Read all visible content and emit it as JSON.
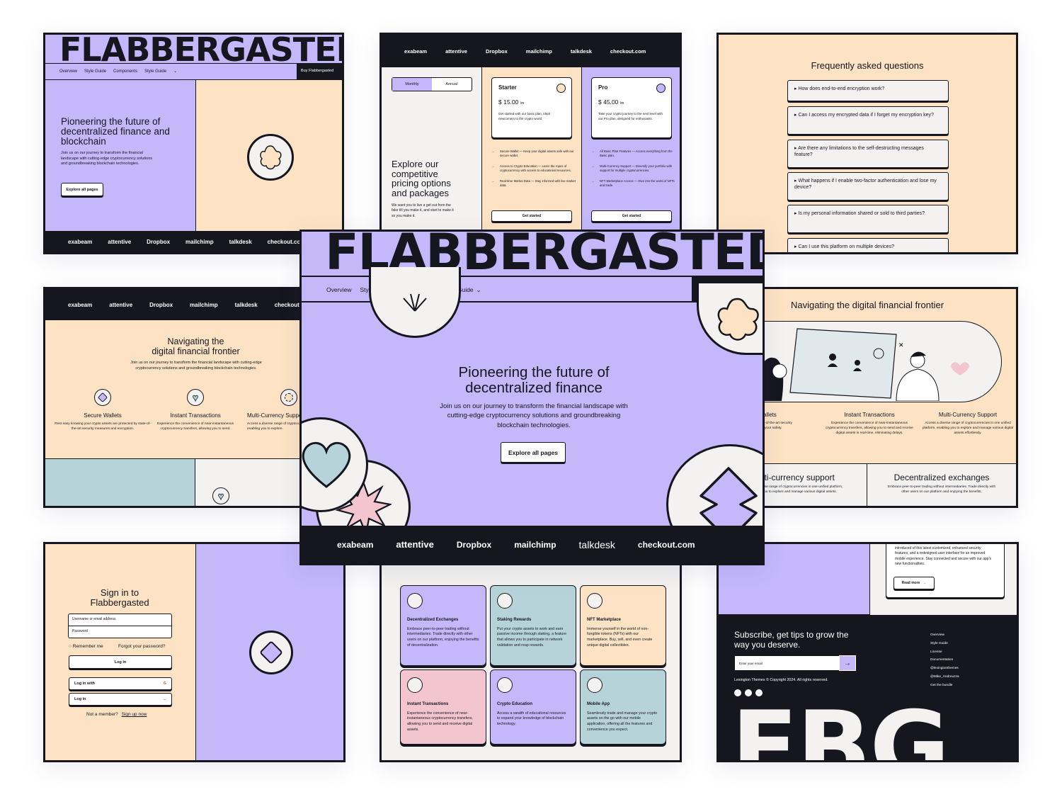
{
  "brand": "FLABBERGASTED",
  "nav": {
    "items": [
      "Overview",
      "Style Guide",
      "Components"
    ],
    "dropdown": "Style Guide",
    "buy": "Buy Flabbergasted"
  },
  "hero": {
    "title_small": "Pioneering the future of decentralized finance and blockchain",
    "title_main": "Pioneering the future of decentralized finance",
    "body": "Join us on our journey to transform the financial landscape with cutting-edge cryptocurrency solutions and groundbreaking blockchain technologies.",
    "cta": "Explore all pages"
  },
  "logos": [
    "exabeam",
    "attentive",
    "Dropbox",
    "mailchimp",
    "talkdesk",
    "checkout.com"
  ],
  "pricing": {
    "toggle": [
      "Monthly",
      "Annual"
    ],
    "title": "Explore our competitive pricing options and packages",
    "body": "We want you to live a get out from the fake till you make it, and start to make it so you make it.",
    "plans": [
      {
        "name": "Starter",
        "price": "$ 15.00",
        "per": "/m",
        "desc": "Get started with our basic plan, ideal newcomers to the crypto world.",
        "features": [
          "Secure Wallet — Keep your digital assets safe with our secure wallet.",
          "Access to Crypto Education — Learn the ropes of cryptocurrency with access to educational resources.",
          "Real-time Market Data — Stay informed with live market data."
        ],
        "cta": "Get started"
      },
      {
        "name": "Pro",
        "price": "$ 45.00",
        "per": "/m",
        "desc": "Take your crypto journey to the next level with our Pro plan, designed for enthusiasts.",
        "features": [
          "All Basic Plan Features — Access everything from the Basic plan.",
          "Multi-Currency Support — Diversify your portfolio with support for multiple cryptocurrencies.",
          "NFT Marketplace Access — Dive into the world of NFTs and trade."
        ],
        "cta": "Get started"
      }
    ]
  },
  "faq": {
    "title": "Frequently asked questions",
    "items": [
      "▸ How does end-to-end encryption work?",
      "▸ Can I access my encrypted data if I forget my encryption key?",
      "▸ Are there any limitations to the self-destructing messages feature?",
      "▸ What happens if I enable two-factor authentication and lose my device?",
      "▸ Is my personal information shared or sold to third parties?",
      "▸ Can I use this platform on multiple devices?"
    ]
  },
  "features": {
    "title": "Navigating the digital financial frontier",
    "title_l1": "Navigating the",
    "title_l2": "digital financial frontier",
    "body": "Join us on our journey to transform the financial landscape with cutting-edge cryptocurrency solutions and groundbreaking blockchain technologies.",
    "items": [
      {
        "name": "Secure Wallets",
        "desc": "Rest easy knowing your crypto assets are protected by state-of-the-art security measures and encryption."
      },
      {
        "name": "Instant Transactions",
        "desc": "Experience the convenience of near-instantaneous cryptocurrency transfers, allowing you to send."
      },
      {
        "name": "Multi-Currency Support",
        "desc": "Access a diverse range of cryptocurrencies in one unified platform, enabling you to explore."
      }
    ],
    "right_items": [
      {
        "name": "Secure Wallets",
        "desc": "your crypto assets are state-of-the-art security encryption, ensuring your safety."
      },
      {
        "name": "Instant Transactions",
        "desc": "Experience the convenience of near-instantaneous cryptocurrency transfers, allowing you to send and receive digital assets in real-time, eliminating delays."
      },
      {
        "name": "Multi-Currency Support",
        "desc": "Access a diverse range of cryptocurrencies in one unified platform, enabling you to explore and manage various digital assets effortlessly."
      }
    ],
    "bottom": [
      {
        "name": "Multi-currency support",
        "desc": "Access a diverse range of cryptocurrencies in one unified platform, enabling you to explore and manage various digital assets."
      },
      {
        "name": "Decentralized exchanges",
        "desc": "Embrace peer-to-peer trading without intermediaries. Trade directly with other users on our platform and enjoying the benefits."
      }
    ]
  },
  "signin": {
    "title": "Sign in to Flabbergasted",
    "username": "Username or email address",
    "password": "Password",
    "remember": "Remember me",
    "forgot": "Forgot your password?",
    "login": "Log in",
    "login_with": "Log in with",
    "login2": "Log in",
    "member": "Not a member?",
    "signup": "Sign up now"
  },
  "grid": [
    {
      "name": "Decentralized Exchanges",
      "desc": "Embrace peer-to-peer trading without intermediaries. Trade directly with other users on our platform, enjoying the benefits of decentralization.",
      "color": "#c4b8fb"
    },
    {
      "name": "Staking Rewards",
      "desc": "Put your crypto assets to work and earn passive income through staking, a feature that allows you to participate in network validation and reap rewards.",
      "color": "#b6d3da"
    },
    {
      "name": "NFT Marketplace",
      "desc": "Immerse yourself in the world of non-fungible tokens (NFTs) with our marketplace. Buy, sell, and even create unique digital collectibles.",
      "color": "#fde3c4"
    },
    {
      "name": "Instant Transactions",
      "desc": "Experience the convenience of near-instantaneous cryptocurrency transfers, allowing you to send and receive digital assets.",
      "color": "#f2c5cf"
    },
    {
      "name": "Crypto Education",
      "desc": "Access a wealth of educational resources to expand your knowledge of blockchain technology.",
      "color": "#c4b8fb"
    },
    {
      "name": "Mobile App",
      "desc": "Seamlessly trade and manage your crypto assets on the go with our mobile application, offering all the features and convenience you expect.",
      "color": "#b6d3da"
    }
  ],
  "footer": {
    "blog_text": "introduced of this latest customized, enhanced security features, and a redesigned user interface for an improved mobile experience. Stay connected and secure with our app's new functionalities.",
    "read_more": "Read more",
    "subscribe": "Subscribe, get tips to grow the way you deserve.",
    "email_placeholder": "Enter your email",
    "copyright": "Lexington Themes © Copyright 2024. All rights reserved.",
    "links": [
      "Overview",
      "Style Guide",
      "License",
      "Documentation",
      "@lexingtonthemes",
      "@Mike_Andreuzza",
      "Get the bundle"
    ],
    "big": "FBG"
  },
  "colors": {
    "lavender": "#c4b8fb",
    "peach": "#fde3c4",
    "blue": "#b6d3da",
    "pink": "#f2c5cf",
    "dark": "#16161f",
    "offwhite": "#f3f2f0"
  }
}
